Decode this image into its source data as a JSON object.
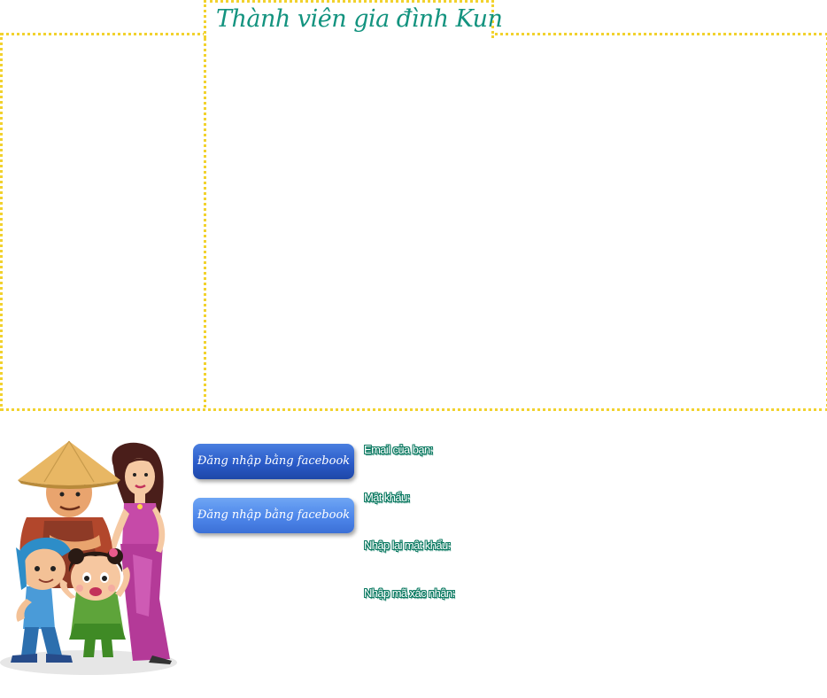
{
  "header": {
    "title": "Thành viên gia đình Kun"
  },
  "social_login": {
    "facebook_primary_label": "Đăng nhập bằng facebook",
    "facebook_secondary_label": "Đăng nhập bằng facebook"
  },
  "register_form": {
    "email_label": "Email của bạn:",
    "email_value": "",
    "password_label": "Mật khẩu:",
    "password_value": "",
    "repeat_password_label": "Nhập lại mật khẩu:",
    "repeat_password_value": "",
    "captcha_label": "Nhập mã xác nhận:",
    "captcha_value": ""
  },
  "colors": {
    "frame_border": "#f2d22e",
    "title_text": "#13937f",
    "label_outline": "#0c7a62",
    "facebook_primary": "#2a5bc8",
    "facebook_secondary": "#4d86ea"
  },
  "illustration": {
    "icon": "kun-family-illustration"
  }
}
